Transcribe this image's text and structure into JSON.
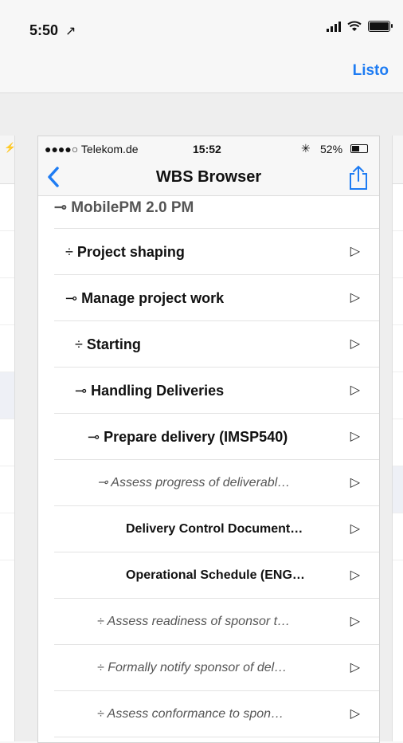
{
  "status_bar": {
    "time": "5:50",
    "location_glyph": "↗"
  },
  "outer_nav": {
    "done_label": "Listo"
  },
  "inner": {
    "status": {
      "carrier": "●●●●○ Telekom.de",
      "wifi": "⨀",
      "time": "15:52",
      "bluetooth": "✳",
      "battery": "52%"
    },
    "title": "WBS Browser",
    "root": "⊸ MobilePM 2.0 PM",
    "rows": [
      {
        "symbol": "÷",
        "label": "Project shaping",
        "style": "bold",
        "indent": 14
      },
      {
        "symbol": "⊸",
        "label": "Manage project work",
        "style": "bold",
        "indent": 14
      },
      {
        "symbol": "÷",
        "label": "Starting",
        "style": "bold",
        "indent": 26
      },
      {
        "symbol": "⊸",
        "label": "Handling Deliveries",
        "style": "bold",
        "indent": 26
      },
      {
        "symbol": "⊸",
        "label": "Prepare delivery (IMSP540)",
        "style": "bold",
        "indent": 42
      },
      {
        "symbol": "⊸",
        "label": "Assess progress of deliverabl…",
        "style": "italic",
        "indent": 54
      },
      {
        "symbol": "",
        "label": "Delivery Control Document…",
        "style": "bold-small",
        "indent": 90
      },
      {
        "symbol": "",
        "label": "Operational Schedule (ENG…",
        "style": "bold-small",
        "indent": 90
      },
      {
        "symbol": "÷",
        "label": "Assess readiness of sponsor t…",
        "style": "italic",
        "indent": 54
      },
      {
        "symbol": "÷",
        "label": "Formally notify sponsor of del…",
        "style": "italic",
        "indent": 54
      },
      {
        "symbol": "÷",
        "label": "Assess conformance to spon…",
        "style": "italic",
        "indent": 54
      }
    ],
    "chevron": "▷"
  },
  "icons": {
    "back": "chevron-left-icon",
    "share": "share-icon",
    "wifi": "wifi-icon",
    "battery": "battery-icon",
    "signal": "signal-icon"
  },
  "colors": {
    "accent": "#1e7cf3"
  }
}
